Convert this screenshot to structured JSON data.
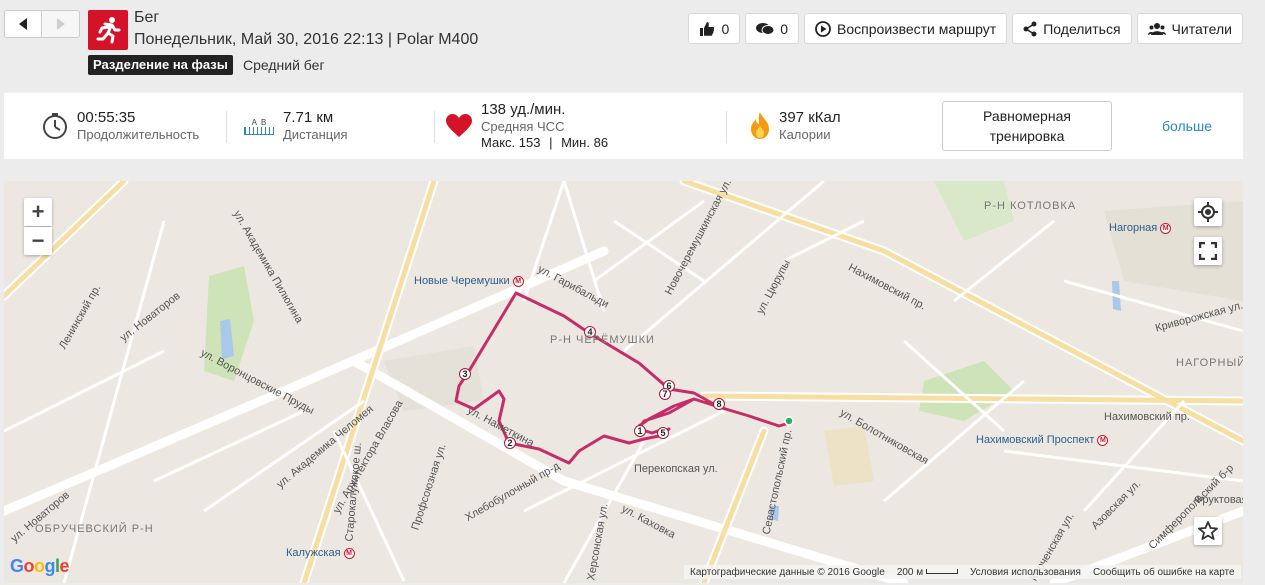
{
  "header": {
    "sport": "Бег",
    "subtitle": "Понедельник, Май 30, 2016 22:13 | Polar M400",
    "phase_badge": "Разделение на фазы",
    "phase_label": "Средний бег",
    "sport_icon": "running-person-icon"
  },
  "actions": {
    "likes": "0",
    "comments": "0",
    "play_route": "Воспроизвести маршрут",
    "share": "Поделиться",
    "readers": "Читатели"
  },
  "summary": {
    "duration_value": "00:55:35",
    "duration_label": "Продолжительность",
    "distance_value": "7.71 км",
    "distance_label": "Дистанция",
    "distance_ab": "A  B",
    "hr_value": "138 уд./мин.",
    "hr_label": "Средняя ЧСС",
    "hr_max": "Макс. 153",
    "hr_sep": "|",
    "hr_min": "Мин. 86",
    "calories_value": "397 кКал",
    "calories_label": "Калории",
    "training_button": "Равномерная тренировка",
    "more_link": "больше"
  },
  "map": {
    "zoom_in": "+",
    "zoom_out": "−",
    "districts": [
      "Р-Н КОТЛОВКА",
      "Р-Н ЧЕРЁМУШКИ",
      "НАГОРНЫЙ",
      "ОБРУЧЕВСКИЙ Р-Н"
    ],
    "metro": [
      "Новые Черемушки",
      "Нагорная",
      "Нахимовский Проспект",
      "Калужская"
    ],
    "streets": [
      "ул. Гарибальди",
      "Нахимовский пр.",
      "Севастопольский пр.",
      "ул. Академика Пилюгина",
      "ул. Новаторов",
      "Ленинский пр.",
      "ул. Наметкина",
      "Профсоюзная ул.",
      "Новочеремушкинская ул.",
      "ул. Цюрупы",
      "Перекопская ул.",
      "ул. Каховка",
      "Хлебобулочный пр-д",
      "ул. Болотниковская",
      "Криворожская ул.",
      "ул. Воронцовские Пруды",
      "ул. Академика Челомея",
      "ул. Архитектора Власова",
      "Старокалужское ш.",
      "Азовская ул.",
      "Симферопольский б-р",
      "Керченская ул.",
      "Херсонская ул.",
      "Фруктовая",
      "ул. Новаторов",
      "Нахимовский пр."
    ],
    "km_markers": [
      "1",
      "2",
      "3",
      "4",
      "5",
      "6",
      "7",
      "8"
    ],
    "footer": {
      "data": "Картографические данные © 2016 Google",
      "scale": "200 м",
      "terms": "Условия использования",
      "report": "Сообщить об ошибке на карте"
    },
    "google": "Google"
  },
  "colors": {
    "accent_red": "#d4132b",
    "route": "#c2185b",
    "link_blue": "#2a86c8"
  }
}
